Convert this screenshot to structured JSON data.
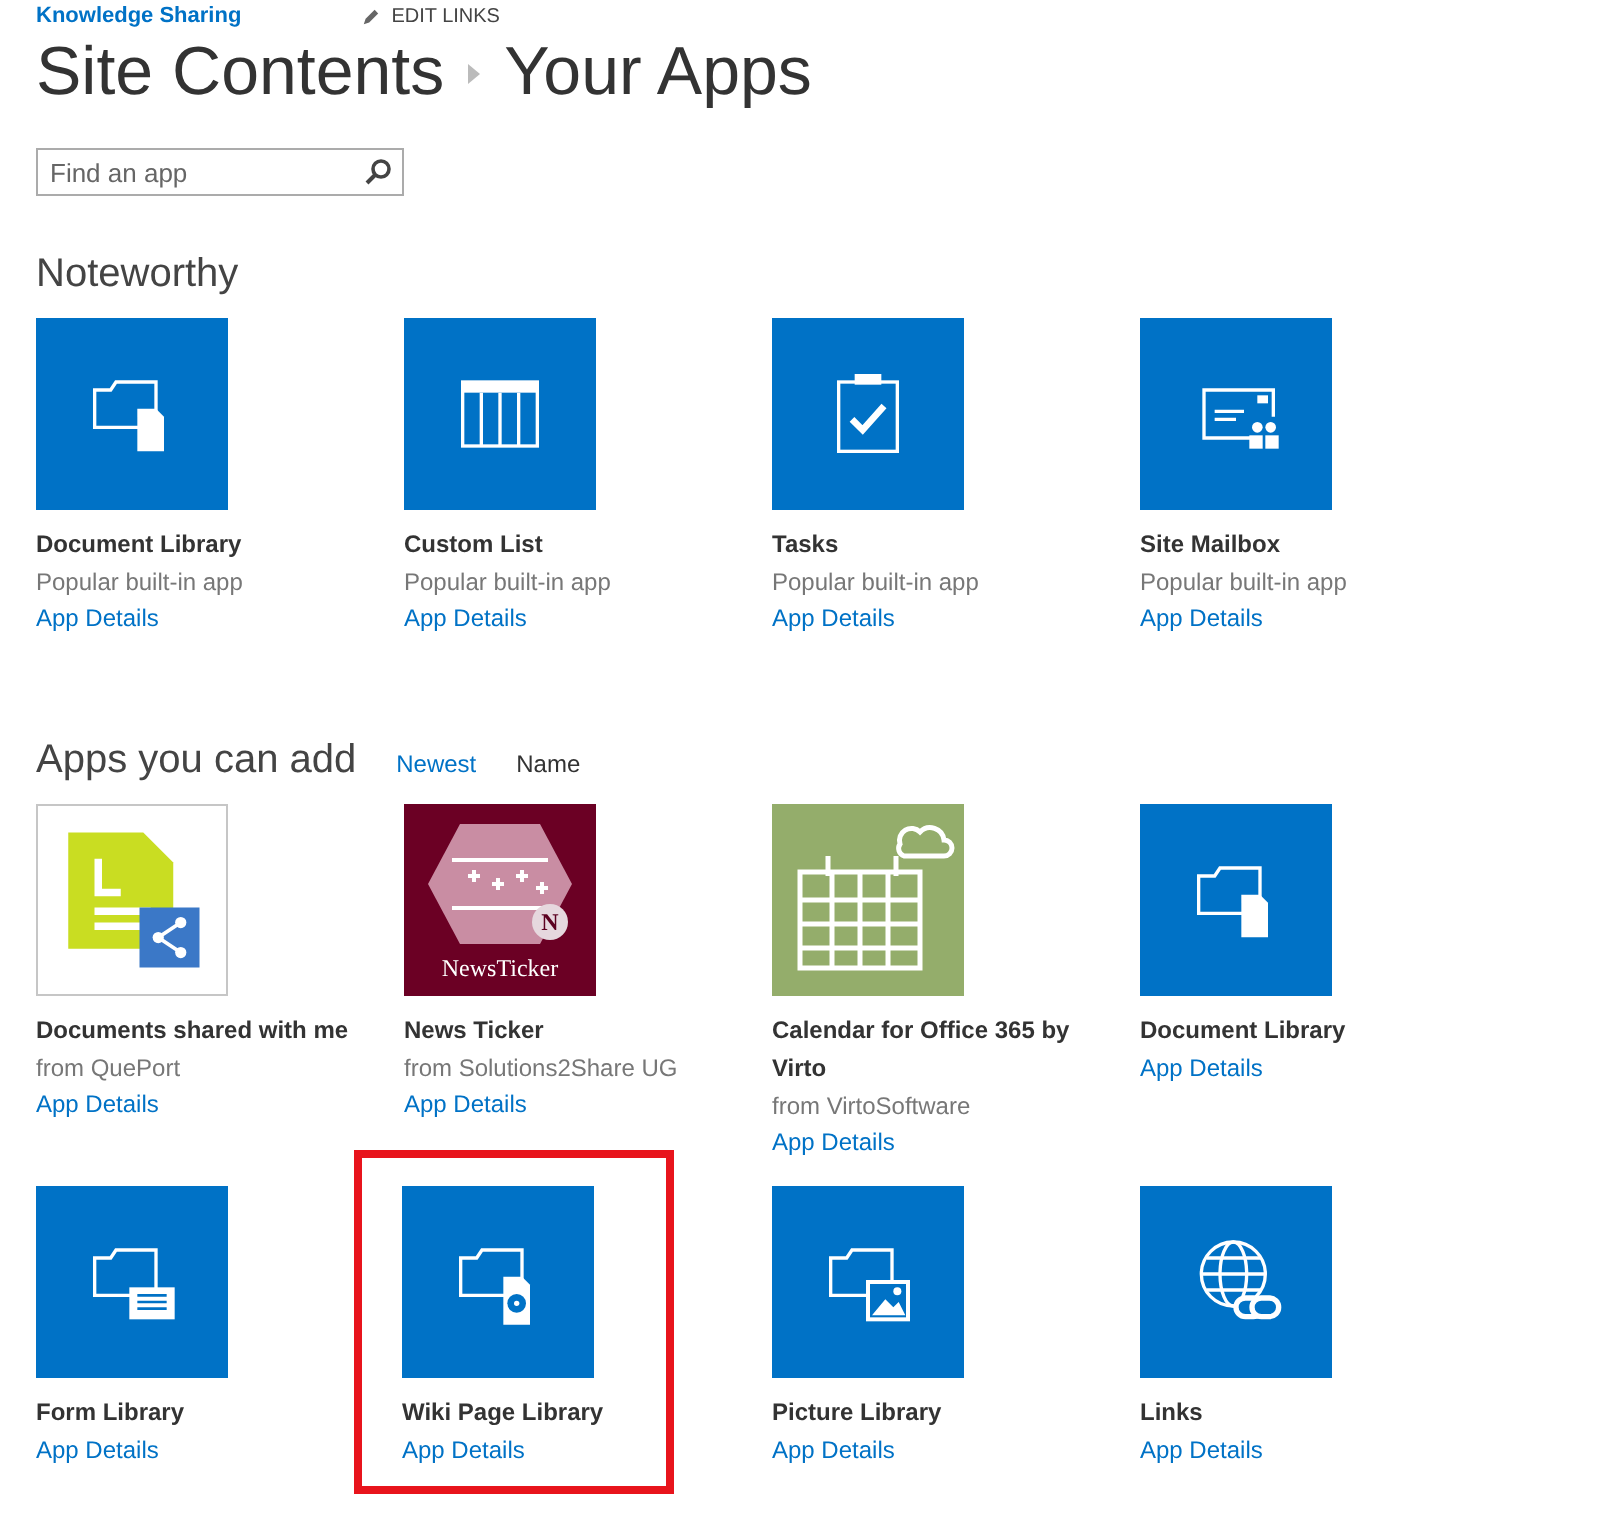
{
  "top_links": [
    {
      "label": "Knowledge Sharing",
      "kind": "site"
    },
    {
      "label": "EDIT LINKS",
      "kind": "edit"
    }
  ],
  "breadcrumb": [
    "Site Contents",
    "Your Apps"
  ],
  "search": {
    "placeholder": "Find an app"
  },
  "noteworthy": {
    "title": "Noteworthy",
    "apps": [
      {
        "name": "Document Library",
        "source": "Popular built-in app",
        "link": "App Details",
        "kind": "doclib",
        "highlighted": false
      },
      {
        "name": "Custom List",
        "source": "Popular built-in app",
        "link": "App Details",
        "kind": "list",
        "highlighted": false
      },
      {
        "name": "Tasks",
        "source": "Popular built-in app",
        "link": "App Details",
        "kind": "tasks",
        "highlighted": false
      },
      {
        "name": "Site Mailbox",
        "source": "Popular built-in app",
        "link": "App Details",
        "kind": "mailbox",
        "highlighted": false
      }
    ]
  },
  "add": {
    "title": "Apps you can add",
    "sorts": [
      {
        "label": "Newest",
        "selected": false
      },
      {
        "label": "Name",
        "selected": true
      }
    ],
    "apps": [
      {
        "name": "Documents shared with me",
        "source": "from QuePort",
        "link": "App Details",
        "kind": "shared",
        "highlighted": false
      },
      {
        "name": "News Ticker",
        "source": "from Solutions2Share UG",
        "link": "App Details",
        "kind": "newsticker",
        "icon_text": "NewsTicker",
        "icon_badge": "N",
        "highlighted": false
      },
      {
        "name": "Calendar for Office 365 by Virto",
        "source": "from VirtoSoftware",
        "link": "App Details",
        "kind": "calendar",
        "highlighted": false
      },
      {
        "name": "Document Library",
        "link": "App Details",
        "kind": "doclib",
        "highlighted": false
      },
      {
        "name": "Form Library",
        "link": "App Details",
        "kind": "form",
        "highlighted": false
      },
      {
        "name": "Wiki Page Library",
        "link": "App Details",
        "kind": "wiki",
        "highlighted": true
      },
      {
        "name": "Picture Library",
        "link": "App Details",
        "kind": "picture",
        "highlighted": false
      },
      {
        "name": "Links",
        "link": "App Details",
        "kind": "links",
        "highlighted": false
      }
    ]
  }
}
